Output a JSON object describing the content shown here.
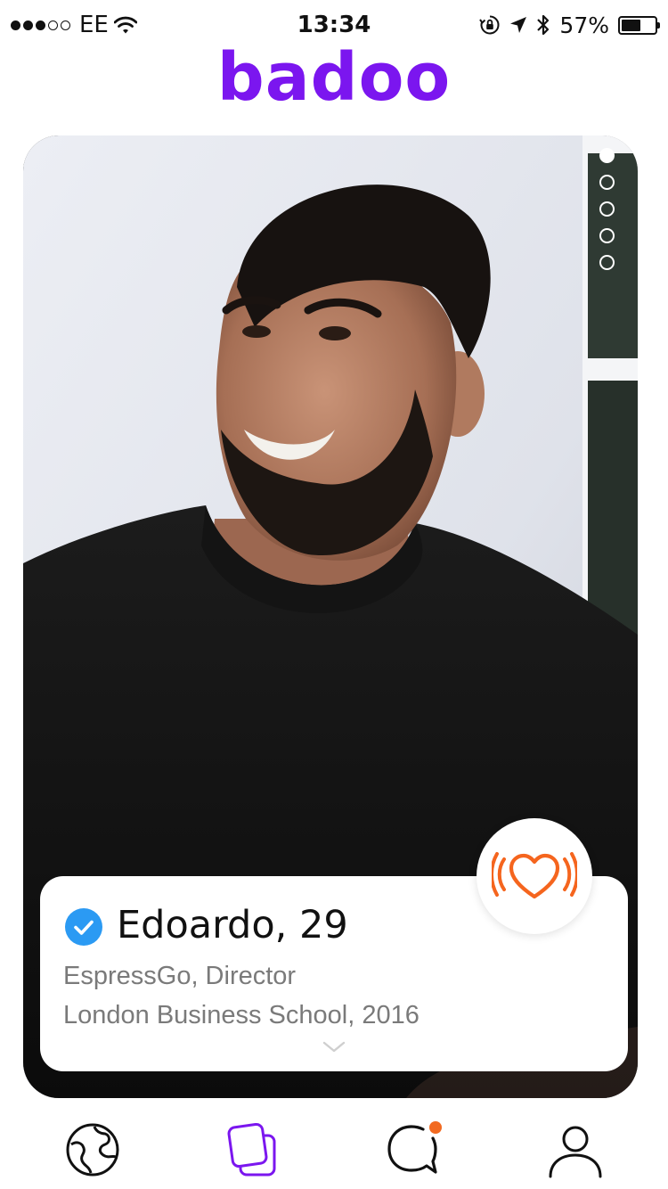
{
  "status_bar": {
    "carrier": "EE",
    "signal_bars_filled": 3,
    "signal_bars_total": 5,
    "time": "13:34",
    "battery_percent": "57%",
    "battery_level": 0.57
  },
  "header": {
    "logo_text": "badoo"
  },
  "profile": {
    "photo_index": 1,
    "photo_count": 5,
    "name_age": "Edoardo, 29",
    "verified": true,
    "job": "EspressGo, Director",
    "education": "London Business School, 2016"
  },
  "actions": {
    "like_icon": "heart-vibrate-icon"
  },
  "nav": {
    "items": [
      {
        "name": "people-nearby",
        "icon": "globe-icon",
        "active": false
      },
      {
        "name": "encounters",
        "icon": "cards-icon",
        "active": true
      },
      {
        "name": "chats",
        "icon": "chat-bubble-icon",
        "active": false,
        "has_notification": true
      },
      {
        "name": "profile",
        "icon": "user-icon",
        "active": false
      }
    ]
  },
  "colors": {
    "brand_purple": "#7b16ef",
    "like_orange": "#f5651e",
    "verified_blue": "#2b9af3",
    "notification_orange": "#f26a21",
    "secondary_text": "#7a7a7a"
  }
}
